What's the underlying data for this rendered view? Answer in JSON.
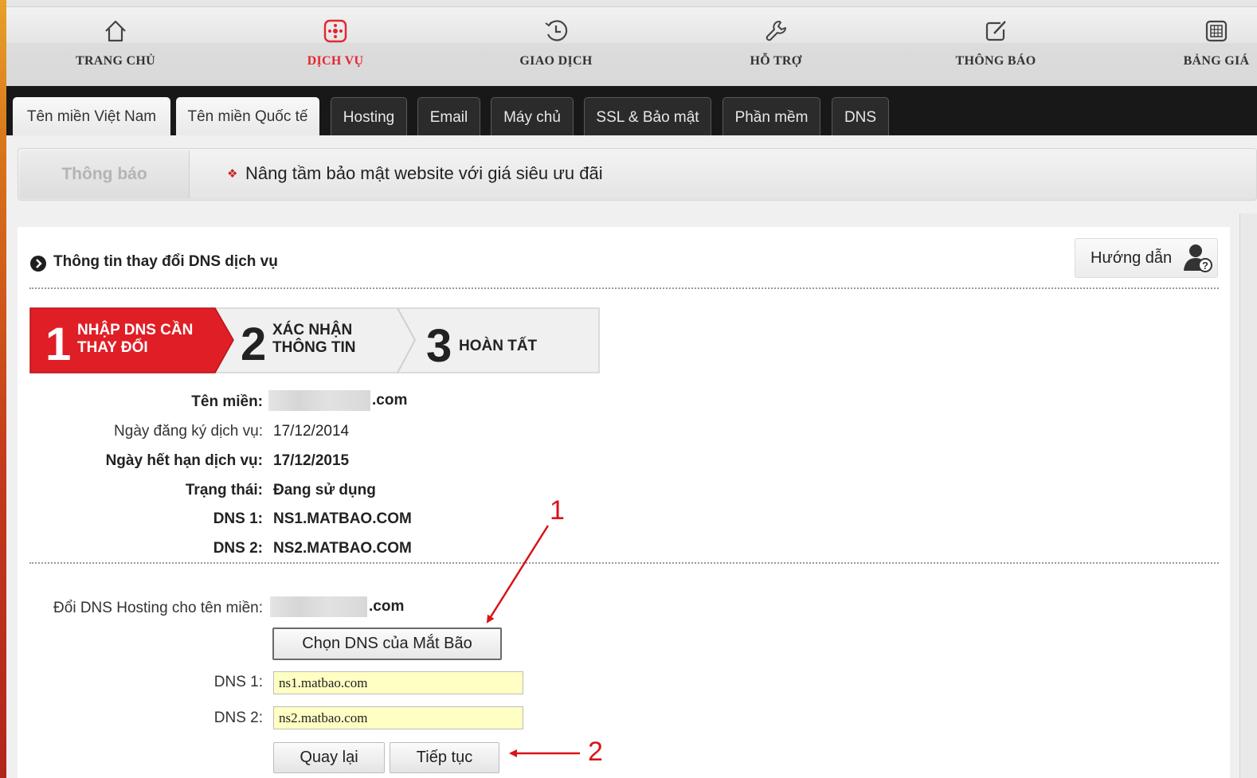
{
  "top_nav": [
    {
      "label": "TRANG CHỦ",
      "icon": "home-icon"
    },
    {
      "label": "DỊCH VỤ",
      "icon": "services-icon",
      "active": true
    },
    {
      "label": "GIAO DỊCH",
      "icon": "transaction-history-icon"
    },
    {
      "label": "HỖ TRỢ",
      "icon": "wrench-icon"
    },
    {
      "label": "THÔNG BÁO",
      "icon": "edit-notice-icon"
    },
    {
      "label": "BẢNG GIÁ",
      "icon": "price-table-icon"
    }
  ],
  "tabs": [
    {
      "label": "Tên miền Việt Nam"
    },
    {
      "label": "Tên miền Quốc tế"
    },
    {
      "label": "Hosting"
    },
    {
      "label": "Email"
    },
    {
      "label": "Máy chủ"
    },
    {
      "label": "SSL & Bảo mật"
    },
    {
      "label": "Phần mềm"
    },
    {
      "label": "DNS"
    }
  ],
  "notice": {
    "label": "Thông báo",
    "text": "Nâng tầm bảo mật website với giá siêu ưu đãi"
  },
  "section": {
    "title": "Thông tin thay đổi DNS dịch vụ",
    "guide_label": "Hướng dẫn"
  },
  "steps": [
    {
      "number": "1",
      "line1": "NHẬP DNS CẦN",
      "line2": "THAY ĐỔI",
      "active": true
    },
    {
      "number": "2",
      "line1": "XÁC NHẬN",
      "line2": "THÔNG TIN",
      "active": false
    },
    {
      "number": "3",
      "line1": "HOÀN TẤT",
      "line2": "",
      "active": false
    }
  ],
  "info": {
    "domain_label": "Tên miền:",
    "domain_suffix": ".com",
    "reg_date_label": "Ngày đăng ký dịch vụ:",
    "reg_date": "17/12/2014",
    "exp_date_label": "Ngày hết hạn dịch vụ:",
    "exp_date": "17/12/2015",
    "status_label": "Trạng thái:",
    "status": "Đang sử dụng",
    "dns1_label": "DNS 1:",
    "dns1": "NS1.MATBAO.COM",
    "dns2_label": "DNS 2:",
    "dns2": "NS2.MATBAO.COM"
  },
  "form": {
    "change_label": "Đổi DNS Hosting cho tên miền:",
    "domain_suffix": ".com",
    "choose_button": "Chọn DNS của Mắt Bão",
    "dns1_label": "DNS 1:",
    "dns1_value": "ns1.matbao.com",
    "dns2_label": "DNS 2:",
    "dns2_value": "ns2.matbao.com",
    "back_button": "Quay lại",
    "continue_button": "Tiếp tục"
  },
  "annotations": {
    "first": "1",
    "second": "2"
  },
  "colors": {
    "accent": "#e3262f",
    "annotation": "#d8141a",
    "input_bg": "#ffffc4"
  }
}
